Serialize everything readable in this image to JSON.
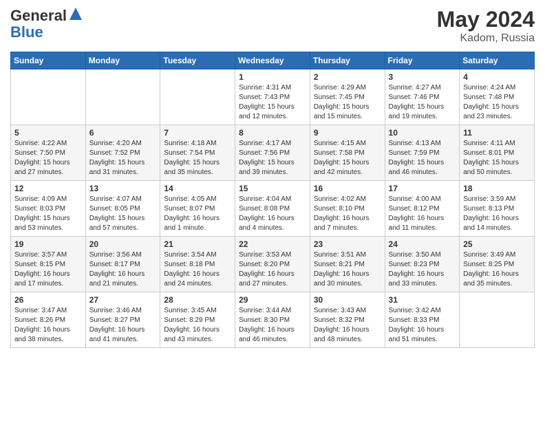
{
  "logo": {
    "general": "General",
    "blue": "Blue"
  },
  "header": {
    "month": "May 2024",
    "location": "Kadom, Russia"
  },
  "weekdays": [
    "Sunday",
    "Monday",
    "Tuesday",
    "Wednesday",
    "Thursday",
    "Friday",
    "Saturday"
  ],
  "weeks": [
    [
      {
        "day": "",
        "sunrise": "",
        "sunset": "",
        "daylight": ""
      },
      {
        "day": "",
        "sunrise": "",
        "sunset": "",
        "daylight": ""
      },
      {
        "day": "",
        "sunrise": "",
        "sunset": "",
        "daylight": ""
      },
      {
        "day": "1",
        "sunrise": "Sunrise: 4:31 AM",
        "sunset": "Sunset: 7:43 PM",
        "daylight": "Daylight: 15 hours and 12 minutes."
      },
      {
        "day": "2",
        "sunrise": "Sunrise: 4:29 AM",
        "sunset": "Sunset: 7:45 PM",
        "daylight": "Daylight: 15 hours and 15 minutes."
      },
      {
        "day": "3",
        "sunrise": "Sunrise: 4:27 AM",
        "sunset": "Sunset: 7:46 PM",
        "daylight": "Daylight: 15 hours and 19 minutes."
      },
      {
        "day": "4",
        "sunrise": "Sunrise: 4:24 AM",
        "sunset": "Sunset: 7:48 PM",
        "daylight": "Daylight: 15 hours and 23 minutes."
      }
    ],
    [
      {
        "day": "5",
        "sunrise": "Sunrise: 4:22 AM",
        "sunset": "Sunset: 7:50 PM",
        "daylight": "Daylight: 15 hours and 27 minutes."
      },
      {
        "day": "6",
        "sunrise": "Sunrise: 4:20 AM",
        "sunset": "Sunset: 7:52 PM",
        "daylight": "Daylight: 15 hours and 31 minutes."
      },
      {
        "day": "7",
        "sunrise": "Sunrise: 4:18 AM",
        "sunset": "Sunset: 7:54 PM",
        "daylight": "Daylight: 15 hours and 35 minutes."
      },
      {
        "day": "8",
        "sunrise": "Sunrise: 4:17 AM",
        "sunset": "Sunset: 7:56 PM",
        "daylight": "Daylight: 15 hours and 39 minutes."
      },
      {
        "day": "9",
        "sunrise": "Sunrise: 4:15 AM",
        "sunset": "Sunset: 7:58 PM",
        "daylight": "Daylight: 15 hours and 42 minutes."
      },
      {
        "day": "10",
        "sunrise": "Sunrise: 4:13 AM",
        "sunset": "Sunset: 7:59 PM",
        "daylight": "Daylight: 15 hours and 46 minutes."
      },
      {
        "day": "11",
        "sunrise": "Sunrise: 4:11 AM",
        "sunset": "Sunset: 8:01 PM",
        "daylight": "Daylight: 15 hours and 50 minutes."
      }
    ],
    [
      {
        "day": "12",
        "sunrise": "Sunrise: 4:09 AM",
        "sunset": "Sunset: 8:03 PM",
        "daylight": "Daylight: 15 hours and 53 minutes."
      },
      {
        "day": "13",
        "sunrise": "Sunrise: 4:07 AM",
        "sunset": "Sunset: 8:05 PM",
        "daylight": "Daylight: 15 hours and 57 minutes."
      },
      {
        "day": "14",
        "sunrise": "Sunrise: 4:05 AM",
        "sunset": "Sunset: 8:07 PM",
        "daylight": "Daylight: 16 hours and 1 minute."
      },
      {
        "day": "15",
        "sunrise": "Sunrise: 4:04 AM",
        "sunset": "Sunset: 8:08 PM",
        "daylight": "Daylight: 16 hours and 4 minutes."
      },
      {
        "day": "16",
        "sunrise": "Sunrise: 4:02 AM",
        "sunset": "Sunset: 8:10 PM",
        "daylight": "Daylight: 16 hours and 7 minutes."
      },
      {
        "day": "17",
        "sunrise": "Sunrise: 4:00 AM",
        "sunset": "Sunset: 8:12 PM",
        "daylight": "Daylight: 16 hours and 11 minutes."
      },
      {
        "day": "18",
        "sunrise": "Sunrise: 3:59 AM",
        "sunset": "Sunset: 8:13 PM",
        "daylight": "Daylight: 16 hours and 14 minutes."
      }
    ],
    [
      {
        "day": "19",
        "sunrise": "Sunrise: 3:57 AM",
        "sunset": "Sunset: 8:15 PM",
        "daylight": "Daylight: 16 hours and 17 minutes."
      },
      {
        "day": "20",
        "sunrise": "Sunrise: 3:56 AM",
        "sunset": "Sunset: 8:17 PM",
        "daylight": "Daylight: 16 hours and 21 minutes."
      },
      {
        "day": "21",
        "sunrise": "Sunrise: 3:54 AM",
        "sunset": "Sunset: 8:18 PM",
        "daylight": "Daylight: 16 hours and 24 minutes."
      },
      {
        "day": "22",
        "sunrise": "Sunrise: 3:53 AM",
        "sunset": "Sunset: 8:20 PM",
        "daylight": "Daylight: 16 hours and 27 minutes."
      },
      {
        "day": "23",
        "sunrise": "Sunrise: 3:51 AM",
        "sunset": "Sunset: 8:21 PM",
        "daylight": "Daylight: 16 hours and 30 minutes."
      },
      {
        "day": "24",
        "sunrise": "Sunrise: 3:50 AM",
        "sunset": "Sunset: 8:23 PM",
        "daylight": "Daylight: 16 hours and 33 minutes."
      },
      {
        "day": "25",
        "sunrise": "Sunrise: 3:49 AM",
        "sunset": "Sunset: 8:25 PM",
        "daylight": "Daylight: 16 hours and 35 minutes."
      }
    ],
    [
      {
        "day": "26",
        "sunrise": "Sunrise: 3:47 AM",
        "sunset": "Sunset: 8:26 PM",
        "daylight": "Daylight: 16 hours and 38 minutes."
      },
      {
        "day": "27",
        "sunrise": "Sunrise: 3:46 AM",
        "sunset": "Sunset: 8:27 PM",
        "daylight": "Daylight: 16 hours and 41 minutes."
      },
      {
        "day": "28",
        "sunrise": "Sunrise: 3:45 AM",
        "sunset": "Sunset: 8:29 PM",
        "daylight": "Daylight: 16 hours and 43 minutes."
      },
      {
        "day": "29",
        "sunrise": "Sunrise: 3:44 AM",
        "sunset": "Sunset: 8:30 PM",
        "daylight": "Daylight: 16 hours and 46 minutes."
      },
      {
        "day": "30",
        "sunrise": "Sunrise: 3:43 AM",
        "sunset": "Sunset: 8:32 PM",
        "daylight": "Daylight: 16 hours and 48 minutes."
      },
      {
        "day": "31",
        "sunrise": "Sunrise: 3:42 AM",
        "sunset": "Sunset: 8:33 PM",
        "daylight": "Daylight: 16 hours and 51 minutes."
      },
      {
        "day": "",
        "sunrise": "",
        "sunset": "",
        "daylight": ""
      }
    ]
  ]
}
